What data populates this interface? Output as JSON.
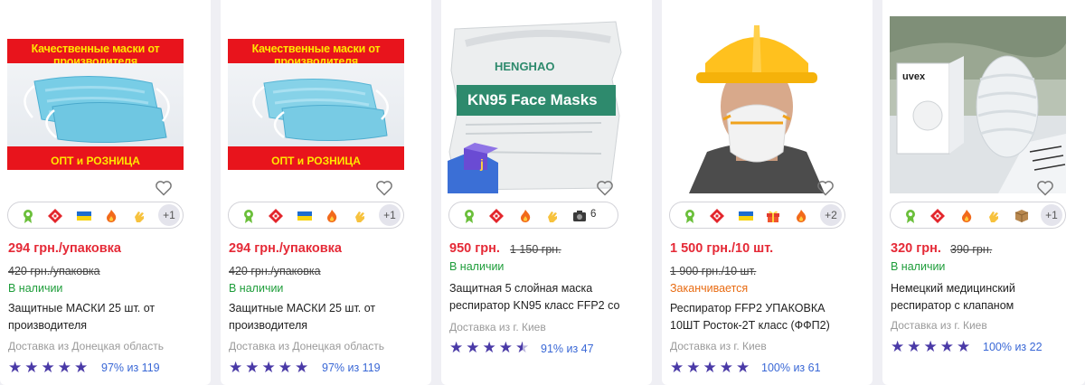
{
  "colors": {
    "price": "#e52a37",
    "in_stock": "#1e9d3a",
    "ending": "#e86b12",
    "rating": "#3a68d6",
    "stars": "#4a3aa7"
  },
  "products": [
    {
      "image_banner_top": "Качественные маски от производителя",
      "image_banner_bottom": "ОПТ и РОЗНИЦА",
      "price": "294 грн./упаковка",
      "old_price": "420 грн./упаковка",
      "stock": "В наличии",
      "title": "Защитные МАСКИ 25 шт. от производителя",
      "delivery": "Доставка из Донецкая область",
      "rating": "97% из 119",
      "stars": 5,
      "more_badges": "+1"
    },
    {
      "image_banner_top": "Качественные маски от производителя",
      "image_banner_bottom": "ОПТ и РОЗНИЦА",
      "price": "294 грн./упаковка",
      "old_price": "420 грн./упаковка",
      "stock": "В наличии",
      "title": "Защитные МАСКИ 25 шт. от производителя",
      "delivery": "Доставка из Донецкая область",
      "rating": "97% из 119",
      "stars": 5,
      "more_badges": "+1"
    },
    {
      "image_brand": "HENGHAO",
      "image_label": "KN95 Face Masks",
      "price": "950 грн.",
      "old_price": "1 150 грн.",
      "stock": "В наличии",
      "title": "Защитная 5 слойная маска респиратор KN95 класс FFP2 со",
      "delivery": "Доставка из г. Киев",
      "rating": "91% из 47",
      "stars": 4.5,
      "photo_count": "6"
    },
    {
      "price": "1 500 грн./10 шт.",
      "old_price": "1 900 грн./10 шт.",
      "stock": "Заканчивается",
      "title": "Респиратор FFP2 УПАКОВКА 10ШТ Росток-2Т класс (ФФП2)",
      "delivery": "Доставка из г. Киев",
      "rating": "100% из 61",
      "stars": 5,
      "more_badges": "+2"
    },
    {
      "image_brand": "uvex",
      "price": "320 грн.",
      "old_price": "390 грн.",
      "stock": "В наличии",
      "title": "Немецкий медицинский респиратор с клапаном",
      "delivery": "Доставка из г. Киев",
      "rating": "100% из 22",
      "stars": 5,
      "more_badges": "+1"
    }
  ]
}
